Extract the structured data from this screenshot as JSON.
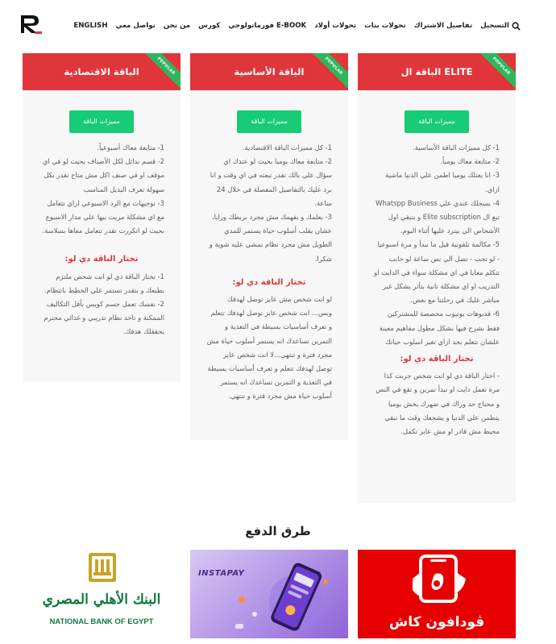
{
  "nav": {
    "items": [
      "التسجيل",
      "تفاصيل الاشتراك",
      "تحولات بنات",
      "تحولات أولاد",
      "فورماتولوجي E-BOOK",
      "كورس",
      "من نحن",
      "تواصل معي",
      "ENGLISH"
    ]
  },
  "cards": [
    {
      "title": "الباقة ال ELITE",
      "badge": "POPULAR",
      "button": "مميزات الباقة",
      "lines": [
        "1- كل مميزات الباقة الأساسية.",
        "2- متابعة معاك يومياً.",
        "3- انا بعتلك يوميا اطمن علي الدنيا ماشية ازاي.",
        "4- بسجلك عندي علي Whatspp Business تبع ال Elite subscription و بتبقي اول الأشخاص الي بيترد عليها أثناء اليوم.",
        "5- مكالمة تلفونية قبل ما نبدأ و مرة اسبوعيا - لو تحب - تصل الي نص ساعة لو حابب تتكلم معايا في اي مشكلة سواء في الدايت او التدريب او اي مشكلة تانية بتأثر بشكل غير مباشر عليك في رحلتنا مع بعض.",
        "6- فديوهات يوتيوب مخصصة للمشتركين فقط بشرح فيها بشكل مطول مفاهيم معينة علشان تتعلم بجد ازاي تغير اسلوب حياتك"
      ],
      "sub": "تختار الباقة دي لو:",
      "sub_lines": [
        "- اختار الباقة دي لو انت شخص جربت كذا مرة تعمل دايت او تبدأ تمرين و تقع في النص و محتاج حد وراك في ضهرك يخش يوميا يتطمن علي الدنيا و يشجعك وقت ما تبقي محبط مش قادر او مش عايز تكمل."
      ]
    },
    {
      "title": "الباقة الأساسية",
      "badge": "POPULAR",
      "button": "مميزات الباقة",
      "lines": [
        "1- كل مميزات الباقة الاقتصادية.",
        "2- متابعة معاك يوميا بحيث لو عندك اي سؤال علي بالك تقدر تبعته في اي وقت و انا برد عليك بالتفاصيل المفصلة في خلال 24 ساعة.",
        "3- بعلمك و بفهمك مش مجرد بربطك ورايا، عشان يقلب أسلوب حياة يستمر للمدي الطويل مش مجرد نظام نمشي عليه شوية و شكرا."
      ],
      "sub": "تختار الباقة دي لو:",
      "sub_lines": [
        "لو انت شخص مش عايز توصل لهدفك وبس... انت شخص عايز توصل لهدفك تتعلم و تعرف أساسيات بسيطة في التغذية و التمرين تساعدك انه يستمر أسلوب حياة مش مجرد فترة و تنتهي...لا انت شخص عايز توصل لهدفك تتعلم و تعرف أساسيات بسيطة في التغذية و التمرين تساعدك انه يستمر أسلوب حياة مش مجرد فترة و تنتهي."
      ]
    },
    {
      "title": "الباقة الاقتصادية",
      "badge": "POPULAR",
      "button": "مميزات الباقة",
      "lines": [
        "1- متابعة معاك أسبوعياً.",
        "2- قسم بدائل لكل الأصناف بحيث لو في اي موقف او في صنف اكل مش متاح تقدر بكل سهولة تعرف البديل المناسب",
        "3- توجيهات مع الرد الاسبوعي ازاي تتعامل مع اي مشكلة مريت بيها علي مدار الاسبوع بحيث لو اتكررت تقدر تتعامل معاها بسلاسة."
      ],
      "sub": "تختار الباقة دي لو:",
      "sub_lines": [
        "1- تختار الباقة دي لو انت شخص ملتزم بطبعك و بتقدر تستمر علي الخطط بانتظام.",
        "2- نفسك تعمل جسم كويس بأقل التكاليف الممكنة و تاخد نظام تدريبي و غذائي محترم يحققلك هدفك."
      ]
    }
  ],
  "payment": {
    "title": "طرق الدفع",
    "vodafone_label": "ڤودافون كاش",
    "instapay_label": "INSTAPAY",
    "nbe_arabic": "البنك الأهلي المصري",
    "nbe_english": "NATIONAL BANK OF EGYPT"
  },
  "colors": {
    "header_red": "#e0363b",
    "button_green": "#17cc74",
    "ribbon_green": "#2db75d",
    "vodafone_red": "#e60000",
    "nbe_green": "#0f7a3e",
    "nbe_gold": "#c9a227"
  }
}
